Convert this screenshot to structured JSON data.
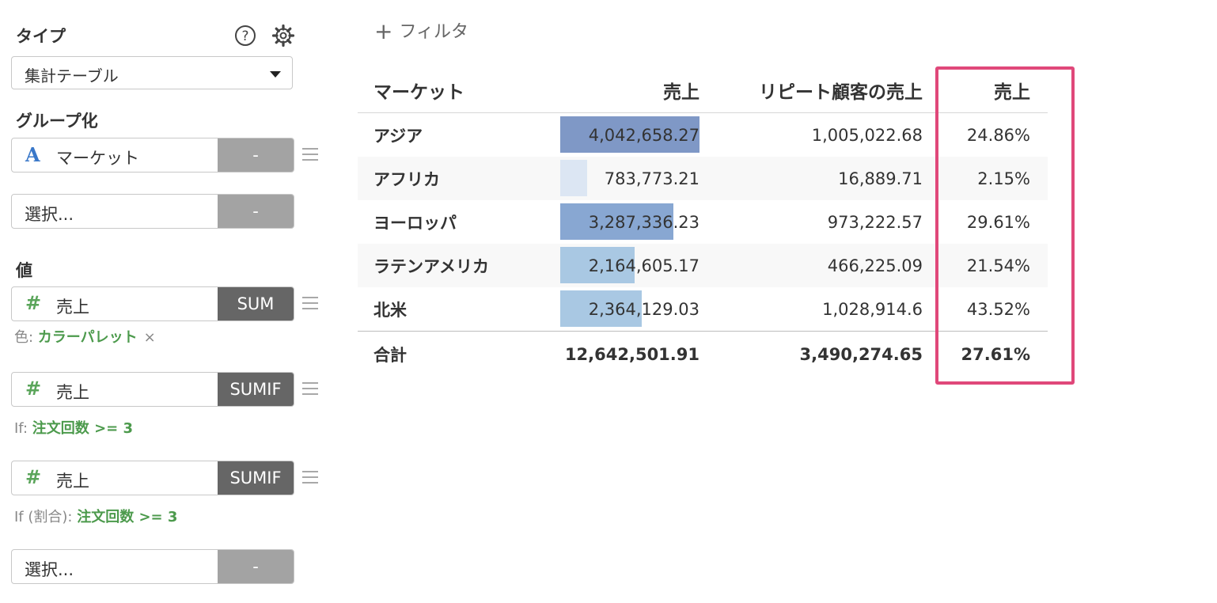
{
  "colors": {
    "bar_asia": "#7f98c6",
    "bar_africa": "#dce6f3",
    "bar_europe": "#88a7d2",
    "bar_latam": "#a9c8e3",
    "bar_na": "#a9c8e3",
    "highlight": "#e0487a"
  },
  "sidebar": {
    "type_label": "タイプ",
    "help_icon": "help-circle-icon",
    "settings_icon": "gear-icon",
    "type_select": {
      "value": "集計テーブル"
    },
    "group_label": "グループ化",
    "group_field": {
      "icon": "A",
      "label": "マーケット",
      "agg": "-"
    },
    "group_select": {
      "label": "選択...",
      "agg": "-"
    },
    "value_label": "値",
    "values": [
      {
        "icon": "#",
        "label": "売上",
        "agg": "SUM",
        "note_prefix": "色: ",
        "note_value": "カラーパレット",
        "note_remove": "×"
      },
      {
        "icon": "#",
        "label": "売上",
        "agg": "SUMIF",
        "note_prefix": "If: ",
        "note_value": "注文回数 >= 3"
      },
      {
        "icon": "#",
        "label": "売上",
        "agg": "SUMIF",
        "note_prefix": "If (割合): ",
        "note_value": "注文回数 >= 3"
      }
    ],
    "value_select": {
      "label": "選択...",
      "agg": "-"
    }
  },
  "filter": {
    "plus": "+",
    "label": "フィルタ"
  },
  "table": {
    "headers": [
      "マーケット",
      "売上",
      "リピート顧客の売上",
      "売上"
    ],
    "rows": [
      {
        "market": "アジア",
        "sales": "4,042,658.27",
        "sales_value": 4042658.27,
        "repeat": "1,005,022.68",
        "ratio": "24.86%"
      },
      {
        "market": "アフリカ",
        "sales": "783,773.21",
        "sales_value": 783773.21,
        "repeat": "16,889.71",
        "ratio": "2.15%"
      },
      {
        "market": "ヨーロッパ",
        "sales": "3,287,336.23",
        "sales_value": 3287336.23,
        "repeat": "973,222.57",
        "ratio": "29.61%"
      },
      {
        "market": "ラテンアメリカ",
        "sales": "2,164,605.17",
        "sales_value": 2164605.17,
        "repeat": "466,225.09",
        "ratio": "21.54%"
      },
      {
        "market": "北米",
        "sales": "2,364,129.03",
        "sales_value": 2364129.03,
        "repeat": "1,028,914.6",
        "ratio": "43.52%"
      }
    ],
    "total": {
      "market": "合計",
      "sales": "12,642,501.91",
      "repeat": "3,490,274.65",
      "ratio": "27.61%"
    }
  }
}
